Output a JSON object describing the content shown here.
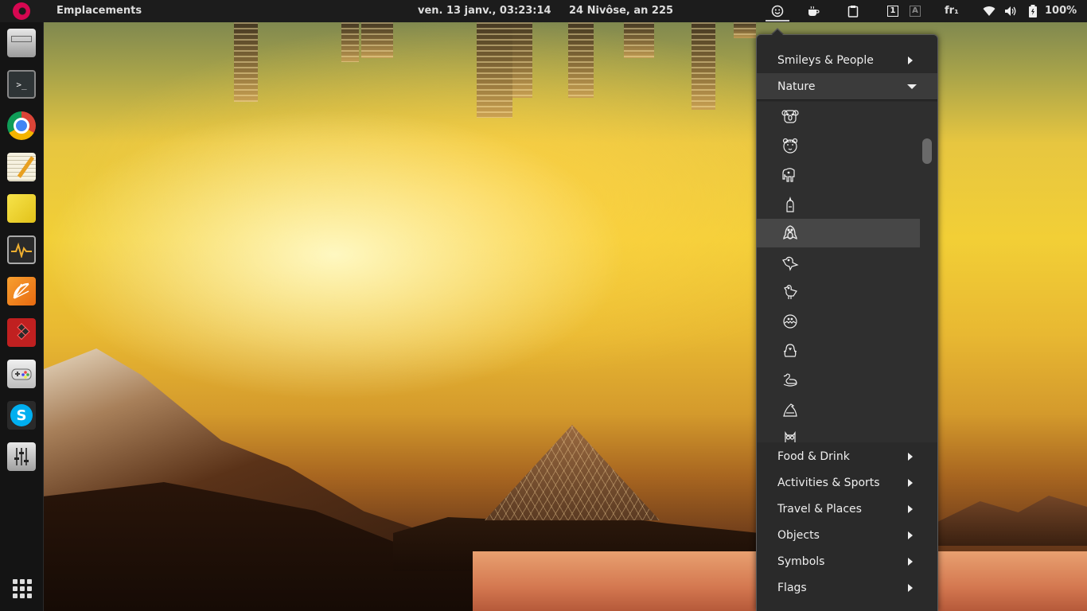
{
  "topbar": {
    "places_label": "Emplacements",
    "clock": "ven. 13 janv., 03:23:14",
    "republican_date": "24 Nivôse, an 225",
    "keyboard_layout": "fr₁",
    "battery_percent": "100%",
    "workspace_active": "1",
    "workspace_other": "A",
    "tray_icons": [
      "emoji-selector-icon",
      "coffee-cup-icon",
      "clipboard-icon",
      "workspace-1-icon",
      "workspace-a-icon",
      "wifi-icon",
      "volume-icon",
      "battery-icon"
    ]
  },
  "dash": {
    "items": [
      "file-manager",
      "terminal",
      "chrome",
      "text-editor",
      "sticky-notes",
      "system-monitor",
      "orange-app",
      "tetris-game",
      "games",
      "skype",
      "mixer"
    ]
  },
  "emoji_menu": {
    "categories": [
      {
        "label": "Smileys & People",
        "open": false
      },
      {
        "label": "Nature",
        "open": true
      },
      {
        "label": "Food & Drink",
        "open": false
      },
      {
        "label": "Activities & Sports",
        "open": false
      },
      {
        "label": "Travel & Places",
        "open": false
      },
      {
        "label": "Objects",
        "open": false
      },
      {
        "label": "Symbols",
        "open": false
      },
      {
        "label": "Flags",
        "open": false
      }
    ],
    "nature_emojis": [
      "koala",
      "tiger-face",
      "elephant",
      "bird-chick",
      "penguin",
      "bird",
      "chicken",
      "hatching-chick",
      "front-facing-chick",
      "duck",
      "eagle",
      "owl"
    ],
    "highlighted_index": 4
  },
  "colors": {
    "topbar_bg": "#1c1c1c",
    "menu_bg": "#2a2a2a",
    "menu_highlight": "#474747",
    "debian_red": "#d70751"
  }
}
